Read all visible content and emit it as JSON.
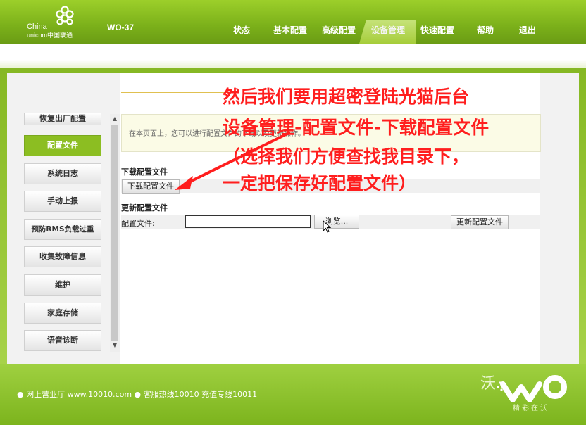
{
  "header": {
    "brand_line1": "China",
    "brand_line2": "unicom中国联通",
    "model": "WO-37",
    "nav": [
      "状态",
      "基本配置",
      "高级配置",
      "设备管理",
      "快速配置",
      "帮助",
      "退出"
    ],
    "active_nav": "设备管理"
  },
  "sidebar": {
    "items": [
      "恢复出厂配置",
      "配置文件",
      "系统日志",
      "手动上报",
      "预防RMS负载过重",
      "收集故障信息",
      "维护",
      "家庭存储",
      "语音诊断"
    ],
    "active": "配置文件"
  },
  "content": {
    "info_text": "在本页面上，您可以进行配置文件的下载以及更新操作。",
    "download_title": "下载配置文件",
    "download_button": "下载配置文件",
    "update_title": "更新配置文件",
    "file_label": "配置文件:",
    "file_value": "",
    "browse_button": "浏览...",
    "update_button": "更新配置文件"
  },
  "annotation": {
    "lines": [
      "然后我们要用超密登陆光猫后台",
      "设备管理-配置文件-下载配置文件",
      "（选择我们方便查找我目录下，",
      "一定把保存好配置文件）"
    ],
    "color": "#ff1e1e"
  },
  "footer": {
    "text": "● 网上营业厅 www.10010.com ● 客服热线10010 充值专线10011",
    "logo_sub": "精彩在沃"
  },
  "colors": {
    "brand_green": "#8cbe22",
    "annotation_red": "#ff1e1e"
  }
}
